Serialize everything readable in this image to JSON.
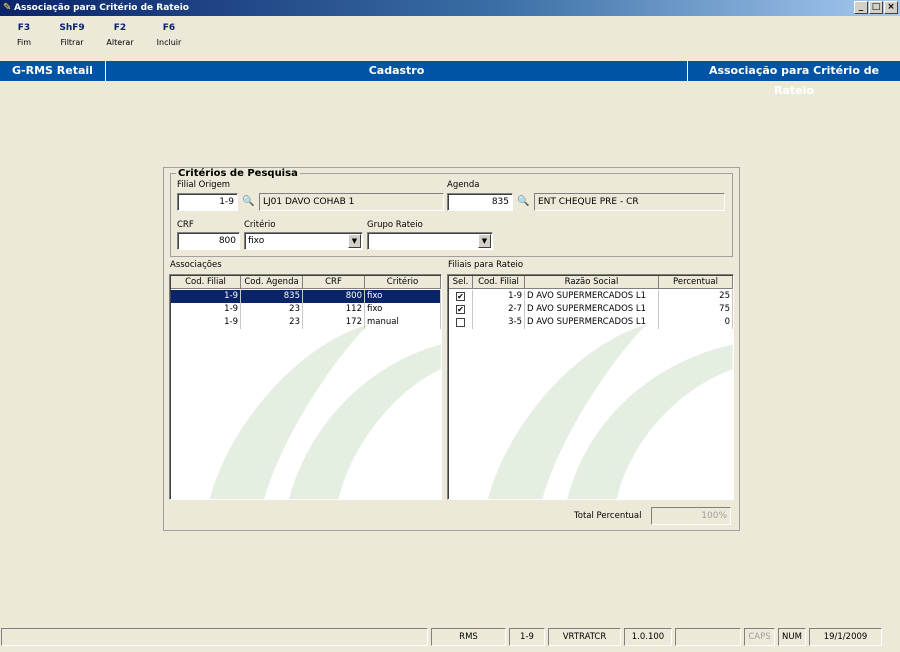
{
  "window": {
    "title": "Associação para Critério de Rateio",
    "buttons": [
      "_",
      "□",
      "×"
    ]
  },
  "toolbar": [
    {
      "key": "F3",
      "label": "Fim"
    },
    {
      "key": "ShF9",
      "label": "Filtrar"
    },
    {
      "key": "F2",
      "label": "Alterar"
    },
    {
      "key": "F6",
      "label": "Incluir"
    }
  ],
  "header": {
    "app": "G-RMS Retail",
    "section": "Cadastro",
    "screen": "Associação para Critério de Rateio"
  },
  "criteria": {
    "legend": "Critérios de Pesquisa",
    "filial_label": "Filial Origem",
    "filial_code": "1-9",
    "filial_name": "LJ01 DAVO COHAB 1",
    "agenda_label": "Agenda",
    "agenda_code": "835",
    "agenda_name": "ENT CHEQUE PRE - CR",
    "crf_label": "CRF",
    "crf_value": "800",
    "criterio_label": "Critério",
    "criterio_value": "fixo",
    "grupo_label": "Grupo Rateio",
    "grupo_value": ""
  },
  "associacoes": {
    "label": "Associações",
    "columns": [
      "Cod. Filial",
      "Cod. Agenda",
      "CRF",
      "Critério"
    ],
    "rows": [
      {
        "filial": "1-9",
        "agenda": "835",
        "crf": "800",
        "criterio": "fixo",
        "selected": true
      },
      {
        "filial": "1-9",
        "agenda": "23",
        "crf": "112",
        "criterio": "fixo",
        "selected": false
      },
      {
        "filial": "1-9",
        "agenda": "23",
        "crf": "172",
        "criterio": "manual",
        "selected": false
      }
    ]
  },
  "filiais": {
    "label": "Filiais para Rateio",
    "columns": [
      "Sel.",
      "Cod. Filial",
      "Razão Social",
      "Percentual"
    ],
    "rows": [
      {
        "checked": true,
        "filial": "1-9",
        "razao": "D AVO SUPERMERCADOS L1",
        "percentual": "25"
      },
      {
        "checked": true,
        "filial": "2-7",
        "razao": "D AVO SUPERMERCADOS L1",
        "percentual": "75"
      },
      {
        "checked": false,
        "filial": "3-5",
        "razao": "D AVO SUPERMERCADOS L1",
        "percentual": "0"
      }
    ]
  },
  "total": {
    "label": "Total Percentual",
    "value": "100%"
  },
  "status": {
    "db": "RMS",
    "filial": "1-9",
    "program": "VRTRATCR",
    "version": "1.0.100",
    "caps": "CAPS",
    "num": "NUM",
    "date": "19/1/2009"
  },
  "colors": {
    "header_blue": "#0054a6",
    "selection": "#0a246a",
    "background": "#ece9d8"
  }
}
